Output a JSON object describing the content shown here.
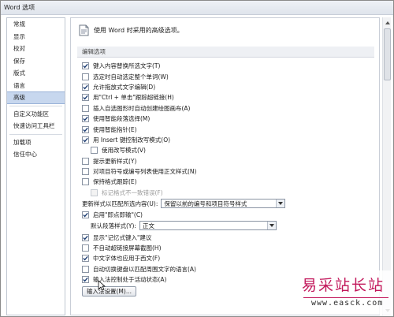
{
  "window": {
    "title": "Word 选项"
  },
  "sidebar": {
    "items": [
      {
        "label": "常规"
      },
      {
        "label": "显示"
      },
      {
        "label": "校对"
      },
      {
        "label": "保存"
      },
      {
        "label": "版式"
      },
      {
        "label": "语言"
      },
      {
        "label": "高级",
        "selected": true
      },
      {
        "label": "自定义功能区"
      },
      {
        "label": "快速访问工具栏"
      },
      {
        "label": "加载项"
      },
      {
        "label": "信任中心"
      }
    ]
  },
  "header": {
    "text": "使用 Word 时采用的高级选项。",
    "icon": "document-options-icon"
  },
  "editing": {
    "section_title": "编辑选项",
    "options": [
      {
        "label": "键入内容替换所选文字(T)",
        "checked": true
      },
      {
        "label": "选定时自动选定整个单词(W)",
        "checked": false
      },
      {
        "label": "允许拖放式文字编辑(D)",
        "checked": true
      },
      {
        "label": "用\"Ctrl + 单击\"跟踪超链接(H)",
        "checked": true
      },
      {
        "label": "插入自选图形时自动创建绘图画布(A)",
        "checked": false
      },
      {
        "label": "使用智能段落选择(M)",
        "checked": true
      },
      {
        "label": "使用智能指针(E)",
        "checked": true
      },
      {
        "label": "用 Insert 键控制改写模式(O)",
        "checked": true
      },
      {
        "label": "使用改写模式(V)",
        "checked": false,
        "indent": true
      },
      {
        "label": "提示更新样式(Y)",
        "checked": false
      },
      {
        "label": "对项目符号或编号列表使用正文样式(N)",
        "checked": false
      },
      {
        "label": "保持格式跟踪(E)",
        "checked": false
      },
      {
        "label": "标记格式不一致错误(F)",
        "checked": false,
        "indent": true,
        "disabled": true
      }
    ],
    "update_style": {
      "label": "更新样式以匹配所选内容(U):",
      "value": "保留以前的编号和项目符号样式"
    },
    "click_type": {
      "label": "启用\"即点即输\"(C)",
      "checked": true
    },
    "default_para": {
      "label": "默认段落样式(Y):",
      "value": "正文"
    },
    "options2": [
      {
        "label": "显示\"记忆式键入\"建议",
        "checked": true
      },
      {
        "label": "不自动超链接屏幕截图(H)",
        "checked": false
      },
      {
        "label": "中文字体也应用于西文(F)",
        "checked": true
      },
      {
        "label": "自动切换键盘以匹配周围文字的语言(A)",
        "checked": false
      },
      {
        "label": "输入法控制处于活动状态(A)",
        "checked": true
      }
    ],
    "ime_button": "输入法设置(M)..."
  },
  "watermark": {
    "text": "易采站长站",
    "url": "www.easck.com"
  },
  "colors": {
    "selected_bg": "#c7d7ee",
    "watermark": "#c2185b",
    "section_bg": "#eef0f4"
  }
}
